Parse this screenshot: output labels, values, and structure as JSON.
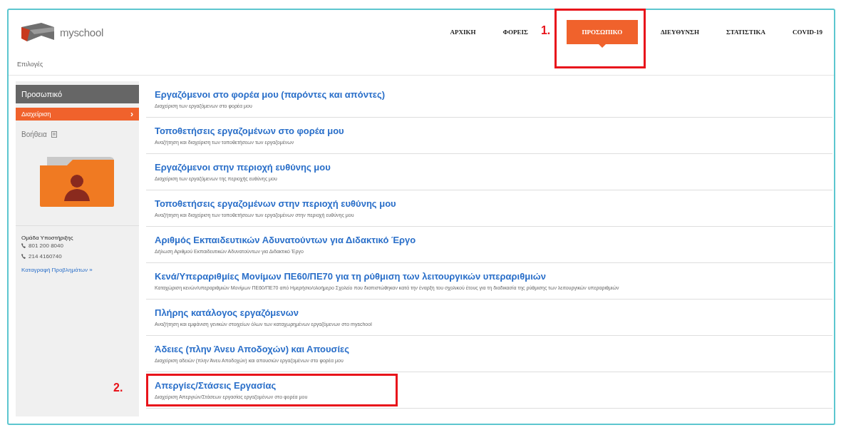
{
  "header": {
    "logo": "myschool",
    "nav": [
      {
        "label": "ΑΡΧΙΚΗ",
        "selected": false,
        "outlined": false
      },
      {
        "label": "ΦΟΡΕΙΣ",
        "selected": false,
        "outlined": false
      },
      {
        "label": "ΠΡΟΣΩΠΙΚΟ",
        "selected": true,
        "outlined": true,
        "callout": "1."
      },
      {
        "label": "ΔΙΕΥΘΥΝΣΗ",
        "selected": false,
        "outlined": false
      },
      {
        "label": "ΣΤΑΤΙΣΤΙΚΑ",
        "selected": false,
        "outlined": false
      },
      {
        "label": "COVID-19",
        "selected": false,
        "outlined": false
      }
    ]
  },
  "breadcrumb": "Επιλογές",
  "sidebar": {
    "title": "Προσωπικό",
    "items": [
      {
        "label": "Διαχείριση",
        "selected": true,
        "arrow": "›"
      }
    ],
    "help": "Βοήθεια",
    "support": {
      "title": "Ομάδα Υποστήριξης",
      "phones": [
        "801 200 8040",
        "214 4160740"
      ],
      "link": "Καταγραφή Προβλημάτων »"
    }
  },
  "items": [
    {
      "title": "Εργαζόμενοι στο φορέα μου (παρόντες και απόντες)",
      "description": "Διαχείριση των εργαζόμενων στο φορέα μου",
      "outlined": false
    },
    {
      "title": "Τοποθετήσεις εργαζομένων στο φορέα μου",
      "description": "Αναζήτηση και διαχείριση των τοποθετήσεων των εργαζομένων",
      "outlined": false
    },
    {
      "title": "Εργαζόμενοι στην περιοχή ευθύνης μου",
      "description": "Διαχείριση των εργαζόμενων της περιοχής ευθύνης μου",
      "outlined": false
    },
    {
      "title": "Τοποθετήσεις εργαζομένων στην περιοχή ευθύνης μου",
      "description": "Αναζήτηση και διαχείριση των τοποθετήσεων των εργαζομένων στην περιοχή ευθύνης μου",
      "outlined": false
    },
    {
      "title": "Αριθμός Εκπαιδευτικών Αδυνατούντων για Διδακτικό Έργο",
      "description": "Δήλωση Αριθμού Εκπαιδευτικών Αδυνατούντων για Διδακτικό Έργο",
      "outlined": false
    },
    {
      "title": "Κενά/Υπεραριθμίες Μονίμων ΠΕ60/ΠΕ70 για τη ρύθμιση των λειτουργικών υπεραριθμιών",
      "description": "Καταχώριση κενών/υπεραριθμιών Μονίμων ΠΕ60/ΠΕ70 από Ημερήσιο/ολοήμερο Σχολείο που διαπιστώθηκαν κατά την έναρξη του σχολικού έτους για τη διαδικασία της ρύθμισης των λειτουργικών υπεραριθμιών",
      "outlined": false
    },
    {
      "title": "Πλήρης κατάλογος εργαζόμενων",
      "description": "Αναζήτηση και εμφάνιση γενικών στοιχείων όλων των καταχωρημένων εργαζόμενων στο myschool",
      "outlined": false
    },
    {
      "title": "Άδειες (πλην Άνευ Αποδοχών) και Απουσίες",
      "description": "Διαχείριση αδειών (πλην Άνευ Αποδοχών) και απουσιών εργαζομένων στο φορέα μου",
      "outlined": false
    },
    {
      "title": "Απεργίες/Στάσεις Εργασίας",
      "description": "Διαχείριση Απεργιών/Στάσεων εργασίας εργαζομένων στο φορέα μου",
      "outlined": true,
      "callout": "2."
    }
  ]
}
